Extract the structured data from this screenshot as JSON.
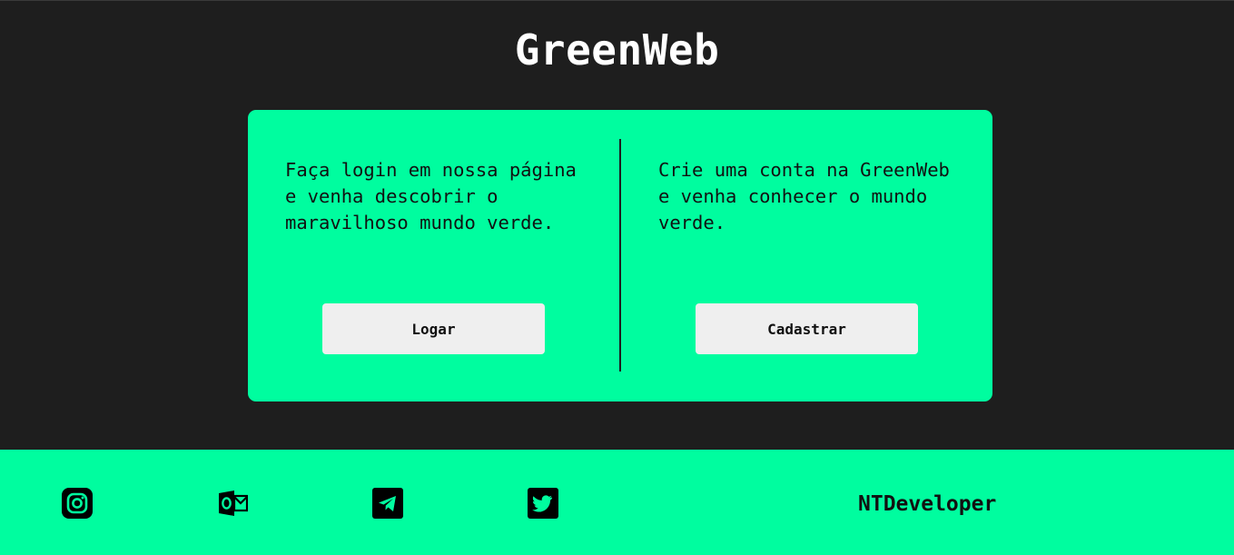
{
  "header": {
    "title": "GreenWeb"
  },
  "login_panel": {
    "text": "Faça login em nossa página e venha descobrir o maravilhoso mundo verde.",
    "button_label": "Logar"
  },
  "signup_panel": {
    "text": "Crie uma conta na GreenWeb e venha conhecer o mundo verde.",
    "button_label": "Cadastrar"
  },
  "footer": {
    "social_icons": [
      "instagram-icon",
      "outlook-icon",
      "telegram-icon",
      "twitter-icon"
    ],
    "brand": "NTDeveloper"
  },
  "colors": {
    "background": "#1e1e1e",
    "accent": "#00fd9f",
    "button": "#efefef",
    "title": "#ffffff"
  }
}
